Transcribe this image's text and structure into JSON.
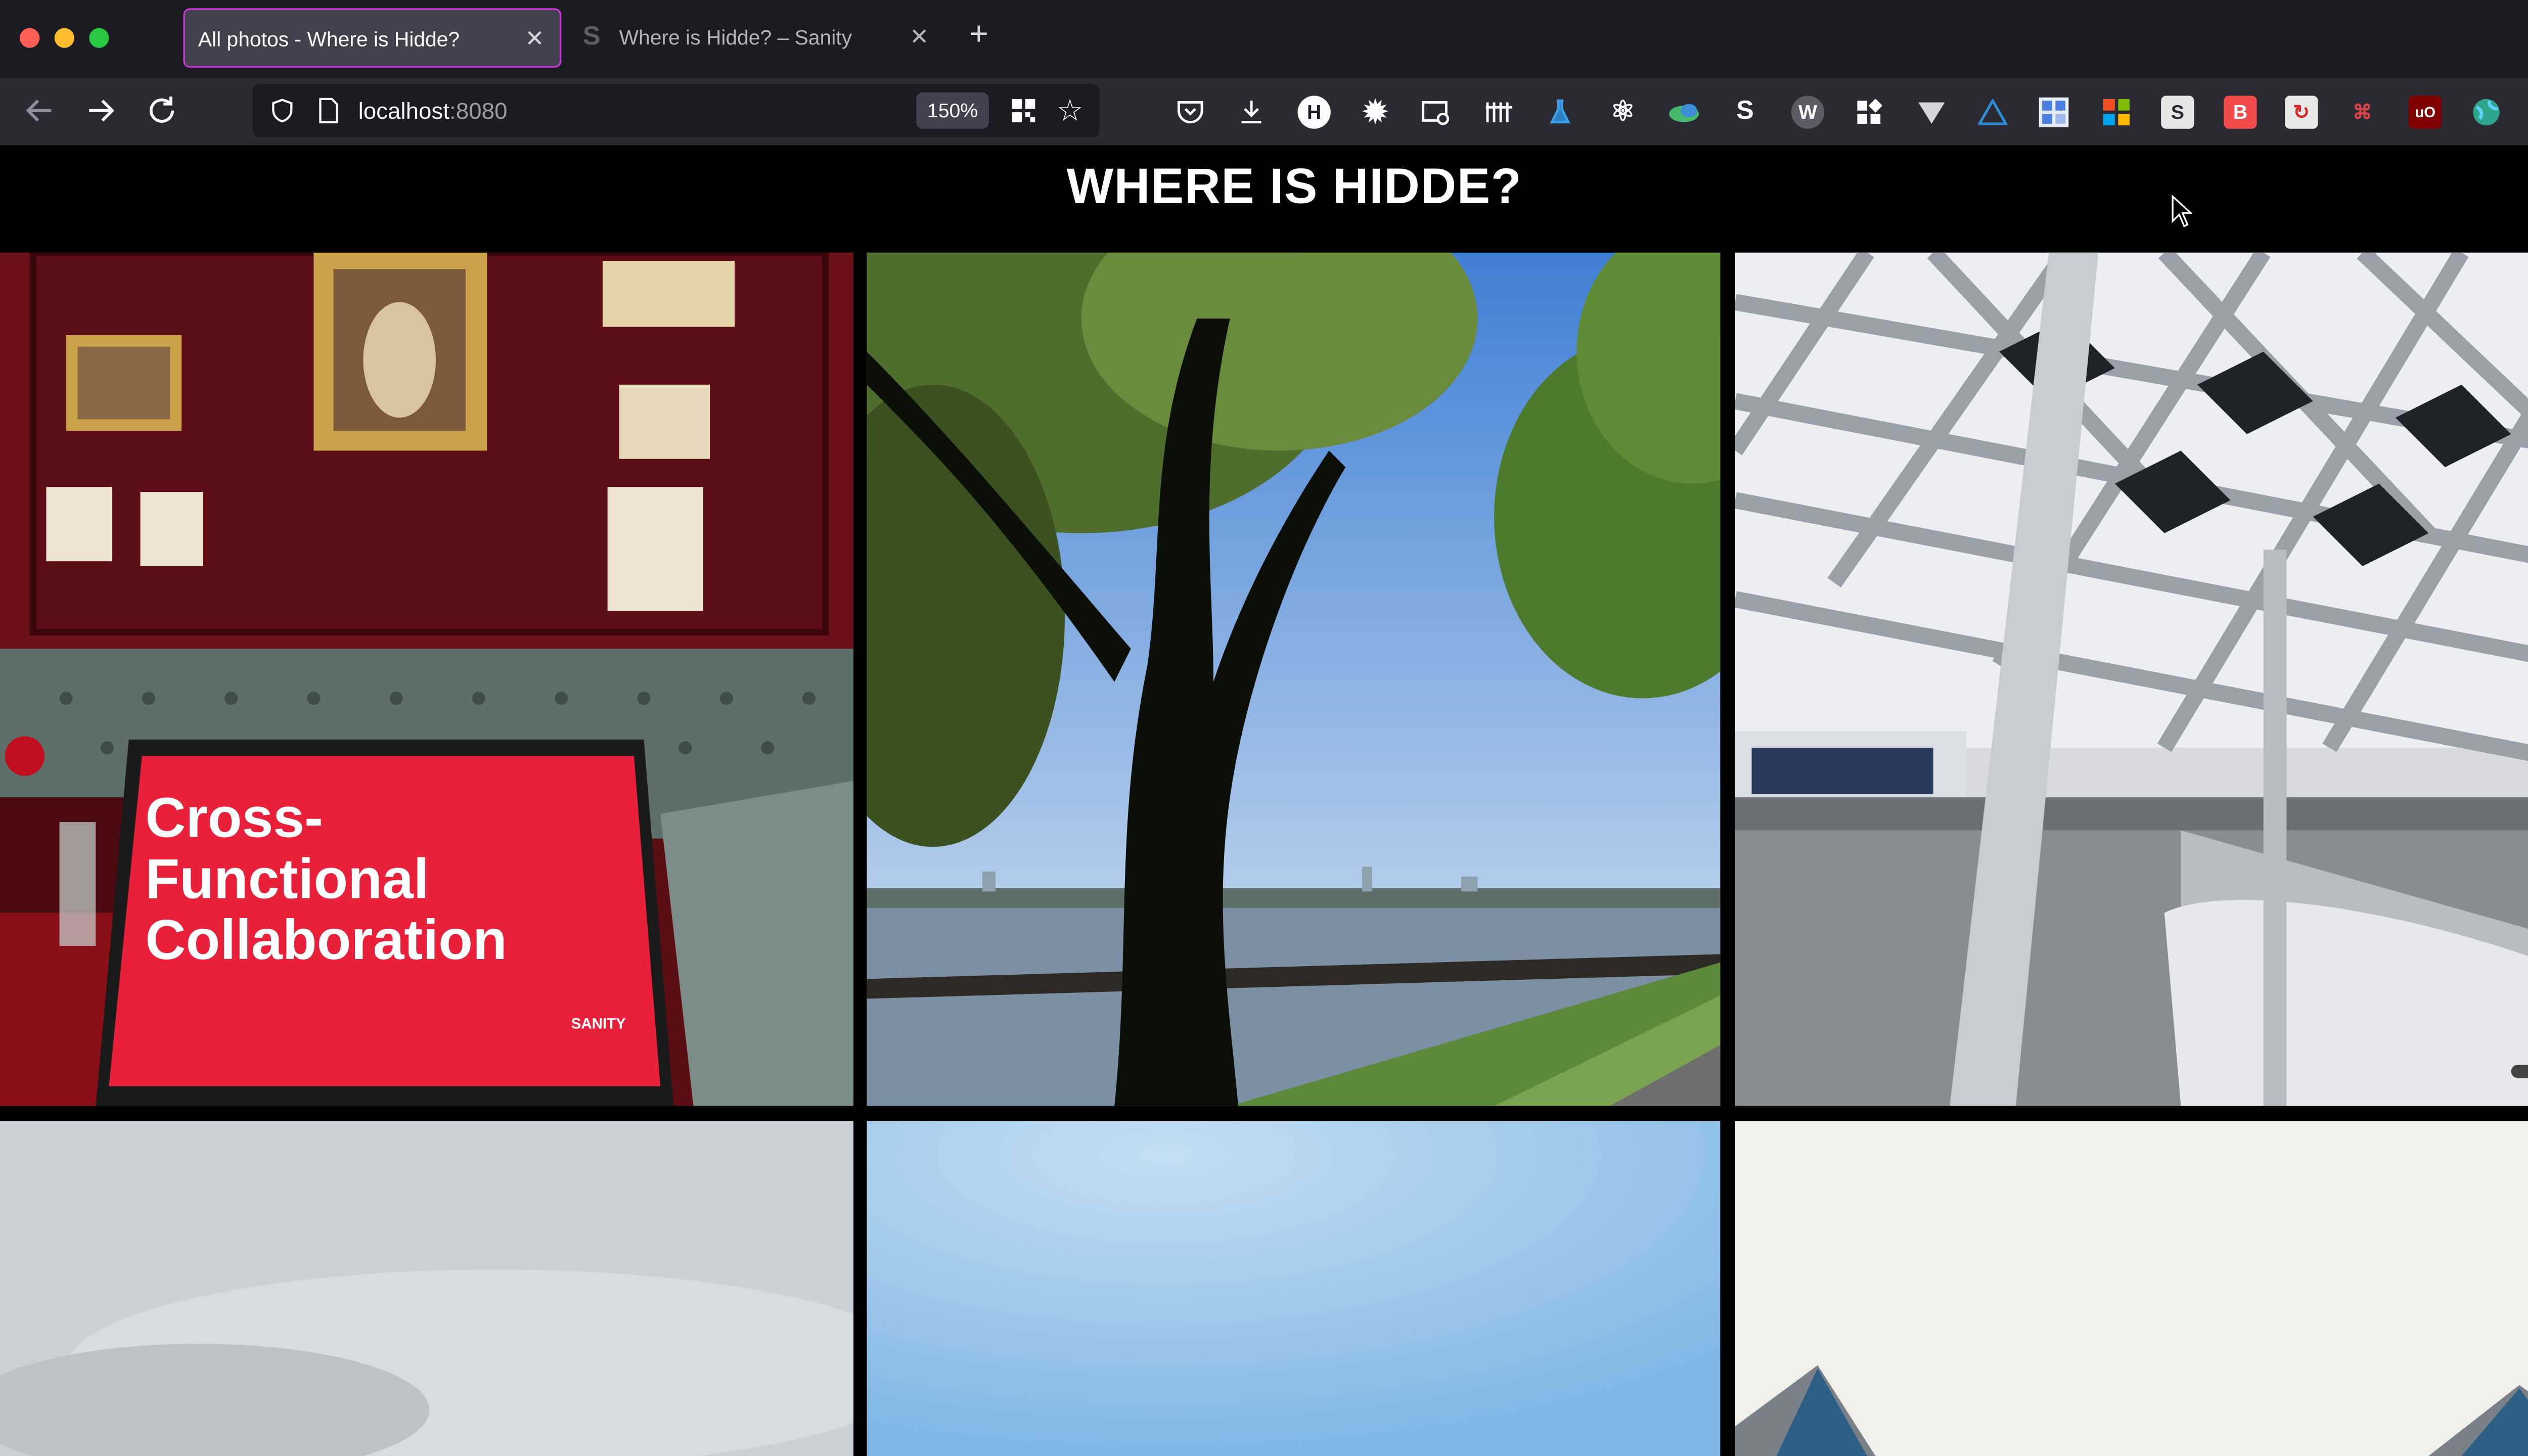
{
  "browser": {
    "tabs": [
      {
        "title": "All photos - Where is Hidde?",
        "active": true
      },
      {
        "title": "Where is Hidde? – Sanity",
        "active": false,
        "favicon_letter": "S"
      }
    ],
    "new_tab_label": "+",
    "url_host": "localhost",
    "url_port": ":8080",
    "zoom_level": "150%",
    "toolbar_icons": [
      "pocket-icon",
      "download-icon",
      "h-extension-icon",
      "gear-extension-icon",
      "screenshot-icon",
      "columns-extension-icon",
      "flask-extension-icon",
      "react-devtools-icon",
      "cloud-extension-icon",
      "s-extension-icon",
      "w-extension-icon",
      "grid-extension-icon",
      "v-extension-icon",
      "triangle-extension-icon",
      "blue-grid-extension-icon",
      "color-grid-extension-icon",
      "s-gray-extension-icon",
      "b-red-extension-icon",
      "refresh-red-extension-icon",
      "link-extension-icon",
      "ublock-icon",
      "globe-extension-icon",
      "menu-icon"
    ]
  },
  "page": {
    "title": "WHERE IS HIDDE?",
    "photos": [
      {
        "description": "red-wall-slide",
        "slide_title": "Cross-\nFunctional\nCollaboration",
        "slide_brand": "SANITY"
      },
      {
        "description": "tree-lake"
      },
      {
        "description": "station-roof"
      },
      {
        "description": "cloudy-sky"
      },
      {
        "description": "blue-sky"
      },
      {
        "description": "building-roofs"
      }
    ]
  },
  "colors": {
    "tab_active_border": "#c738d6",
    "background": "#000000",
    "chrome_dark": "#1c1b22",
    "chrome_mid": "#2b2a33"
  }
}
